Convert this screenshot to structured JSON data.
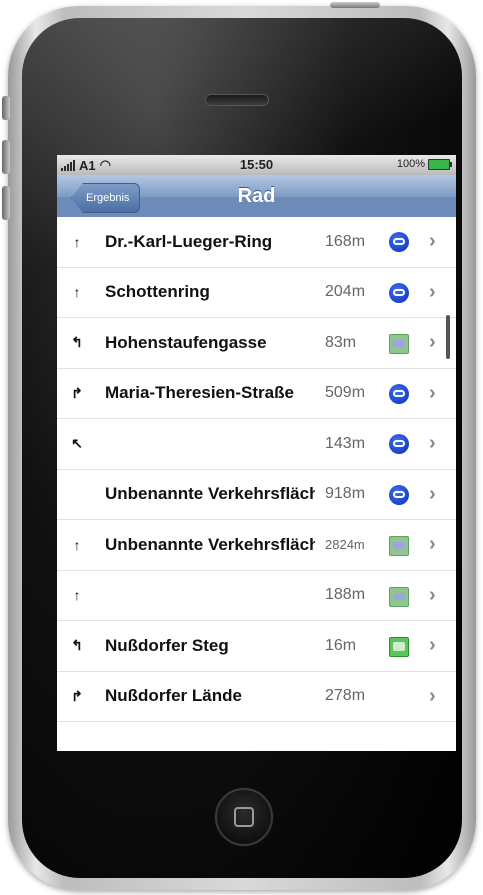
{
  "status_bar": {
    "carrier": "A1",
    "time": "15:50",
    "battery": "100%"
  },
  "nav": {
    "back_label": "Ergebnis",
    "title": "Rad"
  },
  "route_steps": [
    {
      "turn": "straight",
      "street": "Dr.-Karl-Lueger-Ring",
      "distance": "168m",
      "road_type": "bike-lane-icon"
    },
    {
      "turn": "straight",
      "street": "Schottenring",
      "distance": "204m",
      "road_type": "bike-lane-icon"
    },
    {
      "turn": "left",
      "street": "Hohenstaufengasse",
      "distance": "83m",
      "road_type": "bike-path-sign-icon"
    },
    {
      "turn": "right",
      "street": "Maria-Theresien-Straße",
      "distance": "509m",
      "road_type": "bike-lane-icon"
    },
    {
      "turn": "slight-left",
      "street": "",
      "distance": "143m",
      "road_type": "bike-lane-icon"
    },
    {
      "turn": "",
      "street": "Unbenannte Verkehrsfläche",
      "distance": "918m",
      "road_type": "bike-lane-icon"
    },
    {
      "turn": "straight",
      "street": "Unbenannte Verkehrsfläche",
      "distance": "2824m",
      "road_type": "bike-path-sign-icon"
    },
    {
      "turn": "straight",
      "street": "",
      "distance": "188m",
      "road_type": "bike-path-sign-icon"
    },
    {
      "turn": "left",
      "street": "Nußdorfer Steg",
      "distance": "16m",
      "road_type": "green-path-icon"
    },
    {
      "turn": "right",
      "street": "Nußdorfer Lände",
      "distance": "278m",
      "road_type": ""
    }
  ],
  "colors": {
    "nav_bar": "#6d8bb8",
    "bike_lane": "#0a2fb8",
    "bike_path": "#8fc58f"
  }
}
